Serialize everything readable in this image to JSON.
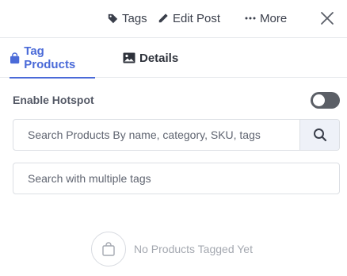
{
  "header": {
    "tags_label": "Tags",
    "edit_label": "Edit Post",
    "more_label": "More"
  },
  "tabs": [
    {
      "label": "Tag Products",
      "active": true
    },
    {
      "label": "Details",
      "active": false
    }
  ],
  "hotspot": {
    "label": "Enable Hotspot",
    "enabled": false
  },
  "search": {
    "placeholder": "Search Products By name, category, SKU, tags",
    "value": ""
  },
  "tags_search": {
    "placeholder": "Search with multiple tags",
    "value": ""
  },
  "empty_state": {
    "message": "No Products Tagged Yet"
  },
  "colors": {
    "accent": "#4a6ad8",
    "toggle_off": "#5b5f66",
    "search_button_bg": "#eef1f8"
  },
  "icons": [
    "tag-icon",
    "pencil-icon",
    "more-dots-icon",
    "close-icon",
    "shopping-bag-icon",
    "image-icon",
    "search-icon",
    "empty-bag-icon"
  ]
}
